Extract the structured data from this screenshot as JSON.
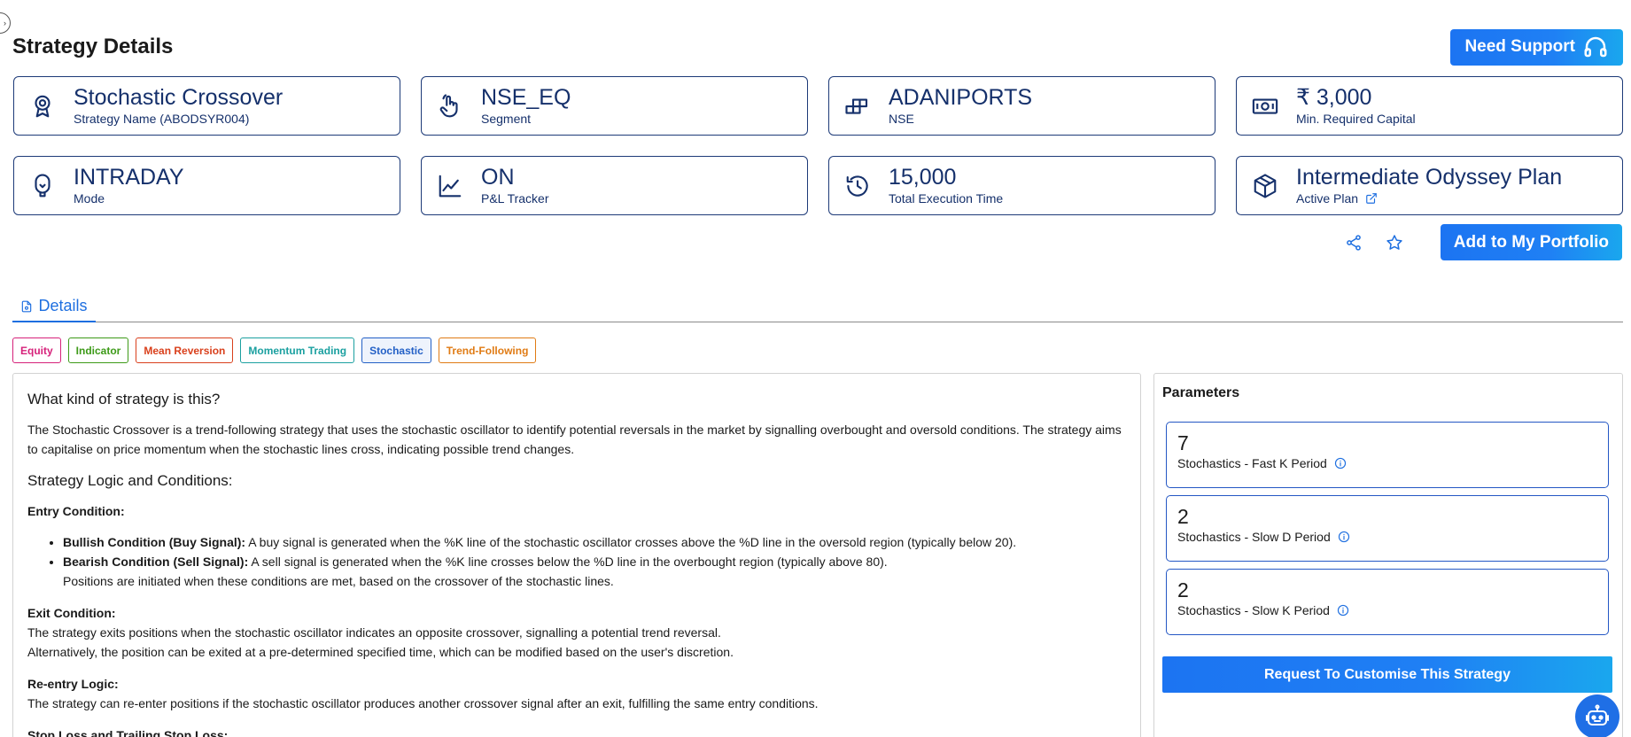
{
  "header": {
    "title": "Strategy Details",
    "support_label": "Need Support"
  },
  "cards": [
    {
      "value": "Stochastic Crossover",
      "label": "Strategy Name (ABODSYR004)",
      "icon": "strategy-badge-icon"
    },
    {
      "value": "NSE_EQ",
      "label": "Segment",
      "icon": "tap-hand-icon"
    },
    {
      "value": "ADANIPORTS",
      "label": "NSE",
      "icon": "blocks-icon"
    },
    {
      "value": "₹ 3,000",
      "label": "Min. Required Capital",
      "icon": "cash-icon"
    },
    {
      "value": "INTRADAY",
      "label": "Mode",
      "icon": "bulb-icon"
    },
    {
      "value": "ON",
      "label": "P&L Tracker",
      "icon": "line-chart-icon"
    },
    {
      "value": "15,000",
      "label": "Total Execution Time",
      "icon": "history-icon"
    },
    {
      "value": "Intermediate Odyssey Plan",
      "label": "Active Plan",
      "icon": "package-icon"
    }
  ],
  "actions": {
    "portfolio_label": "Add to My Portfolio"
  },
  "tabs": [
    {
      "label": "Details"
    }
  ],
  "tags": [
    {
      "label": "Equity",
      "color": "#d6217a"
    },
    {
      "label": "Indicator",
      "color": "#3d9a18"
    },
    {
      "label": "Mean Reversion",
      "color": "#d9401c"
    },
    {
      "label": "Momentum Trading",
      "color": "#1ba0a0"
    },
    {
      "label": "Stochastic",
      "color": "#2360c6"
    },
    {
      "label": "Trend-Following",
      "color": "#e07b14"
    }
  ],
  "details": {
    "q1": "What kind of strategy is this?",
    "p1": "The Stochastic Crossover is a trend-following strategy that uses the stochastic oscillator to identify potential reversals in the market by signalling overbought and oversold conditions. The strategy aims to capitalise on price momentum when the stochastic lines cross, indicating possible trend changes.",
    "q2": "Strategy Logic and Conditions:",
    "entry_title": "Entry Condition:",
    "entry_items": [
      {
        "bold": "Bullish Condition (Buy Signal):",
        "text": " A buy signal is generated when the %K line of the stochastic oscillator crosses above the %D line in the oversold region (typically below 20)."
      },
      {
        "bold": "Bearish Condition (Sell Signal):",
        "text": " A sell signal is generated when the %K line crosses below the %D line in the overbought region (typically above 80)."
      }
    ],
    "entry_note": "Positions are initiated when these conditions are met, based on the crossover of the stochastic lines.",
    "exit_title": "Exit Condition:",
    "exit_line1": "The strategy exits positions when the stochastic oscillator indicates an opposite crossover, signalling a potential trend reversal.",
    "exit_line2": "Alternatively, the position can be exited at a pre-determined specified time, which can be modified based on the user's discretion.",
    "reentry_title": "Re-entry Logic:",
    "reentry_line": "The strategy can re-enter positions if the stochastic oscillator produces another crossover signal after an exit, fulfilling the same entry conditions.",
    "sl_title": "Stop Loss and Trailing Stop Loss:"
  },
  "parameters": {
    "title": "Parameters",
    "items": [
      {
        "value": "7",
        "label": "Stochastics - Fast K Period"
      },
      {
        "value": "2",
        "label": "Stochastics - Slow D Period"
      },
      {
        "value": "2",
        "label": "Stochastics - Slow K Period"
      }
    ],
    "customise_label": "Request To Customise This Strategy"
  }
}
